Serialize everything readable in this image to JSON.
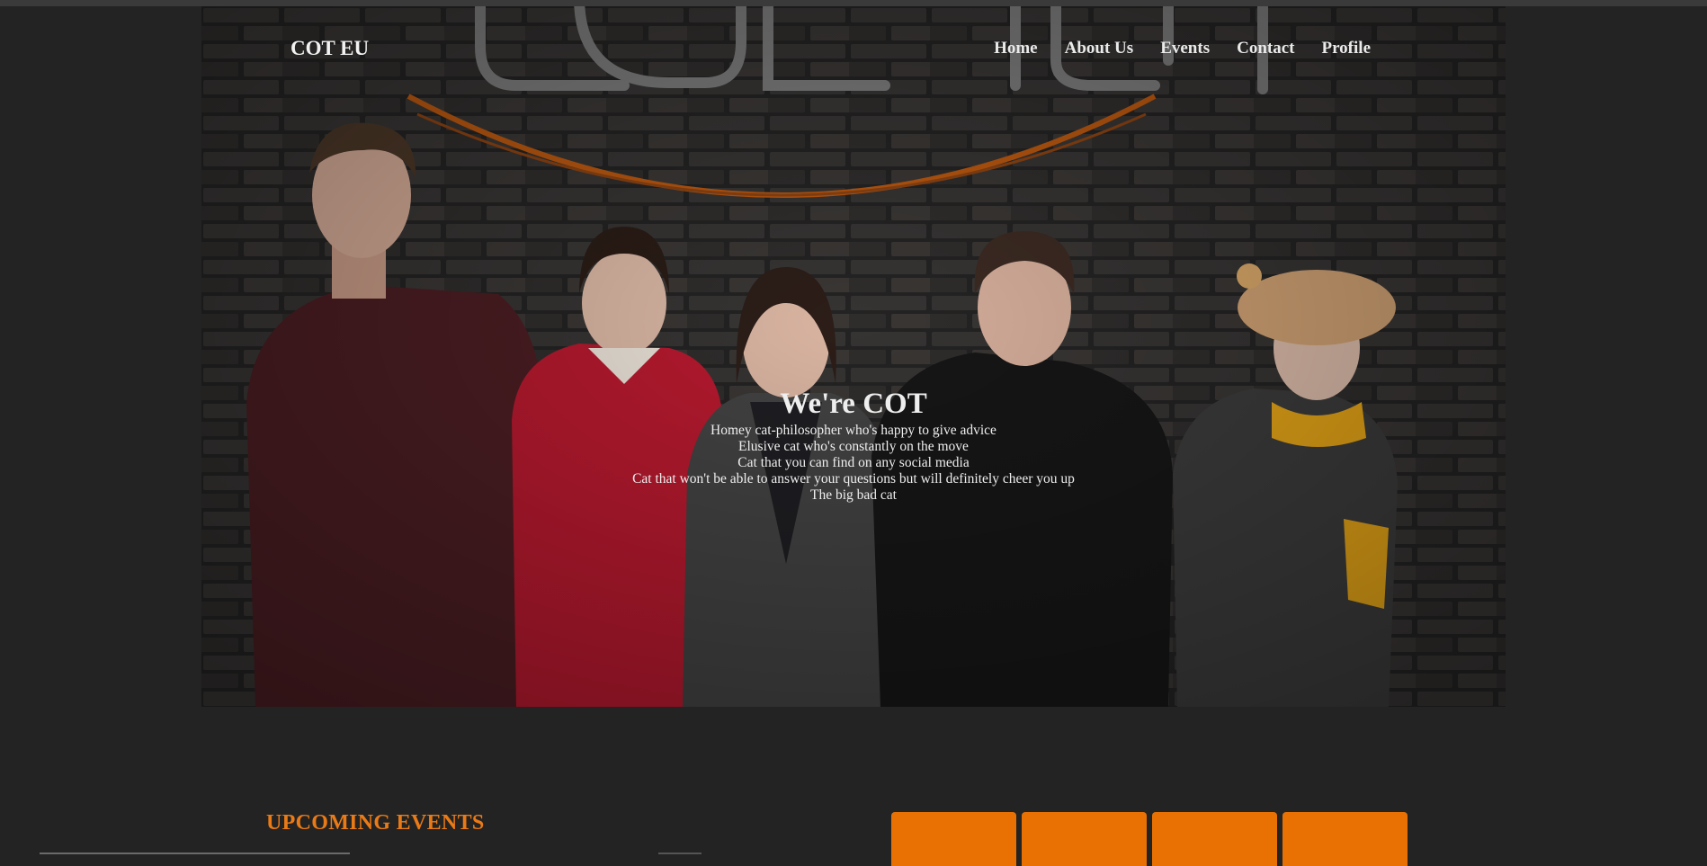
{
  "brand": "COT EU",
  "nav": {
    "items": [
      {
        "label": "Home"
      },
      {
        "label": "About Us"
      },
      {
        "label": "Events"
      },
      {
        "label": "Contact"
      },
      {
        "label": "Profile"
      }
    ]
  },
  "hero": {
    "title": "We're COT",
    "lines": [
      "Homey cat-philosopher who's happy to give advice",
      "Elusive cat who's constantly on the move",
      "Cat that you can find on any social media",
      "Cat that won't be able to answer your questions but will definitely cheer you up",
      "The big bad cat"
    ],
    "image": "team-photo-in-front-of-brick-wall-with-logo"
  },
  "events": {
    "title": "UPCOMING EVENTS",
    "tabs": [
      {
        "label": ""
      },
      {
        "label": ""
      },
      {
        "label": ""
      },
      {
        "label": ""
      }
    ]
  },
  "colors": {
    "background": "#232323",
    "accent": "#e97104",
    "heading_accent": "#ea7a16",
    "nav_text": "#eaeaea"
  }
}
